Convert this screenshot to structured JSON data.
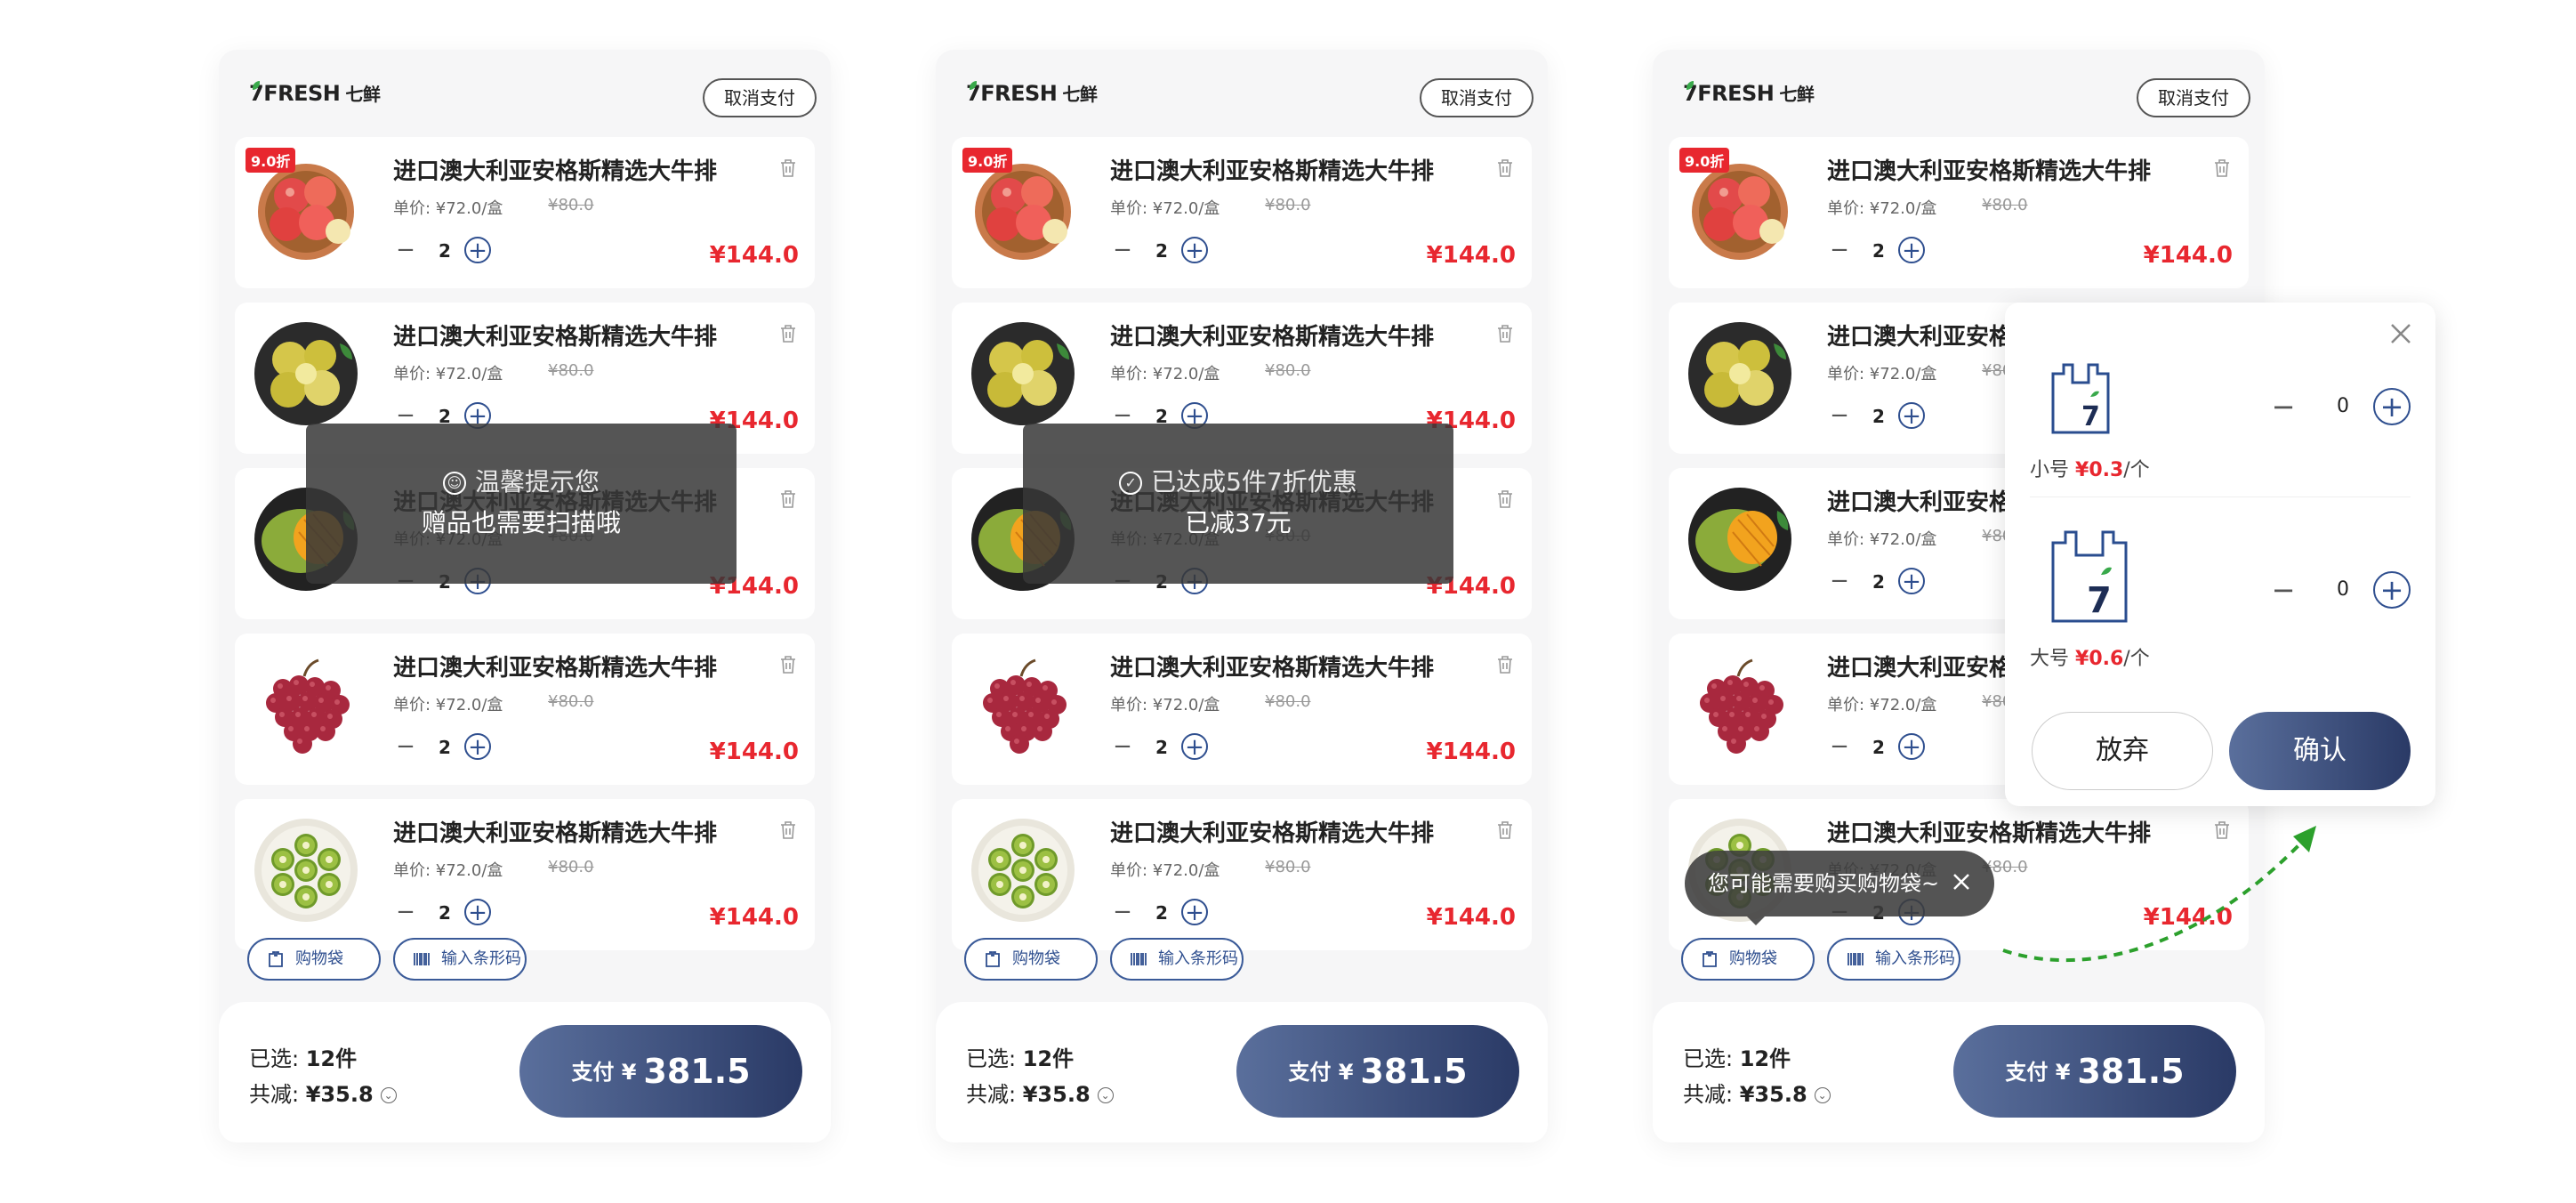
{
  "app": {
    "logo_text": "7FRESH",
    "logo_cn": "七鲜",
    "cancel_pay": "取消支付"
  },
  "product": {
    "name": "进口澳大利亚安格斯精选大牛排",
    "unit_price": "单价: ¥72.0/盒",
    "original_price": "¥80.0",
    "qty": "2",
    "total": "¥144.0",
    "discount_badge": "9.0折",
    "minus_symbol": "−",
    "plus_symbol": "+"
  },
  "products": [
    {
      "fruit": "apple",
      "badge": true
    },
    {
      "fruit": "pear",
      "badge": false
    },
    {
      "fruit": "mango",
      "badge": false
    },
    {
      "fruit": "grape",
      "badge": false
    },
    {
      "fruit": "kiwi",
      "badge": false
    }
  ],
  "chips": {
    "bag": "购物袋",
    "barcode": "输入条形码"
  },
  "footer": {
    "selected_label": "已选:",
    "selected_value": "12件",
    "discount_label": "共减:",
    "discount_value": "¥35.8",
    "pay_label": "支付 ¥",
    "pay_amount": "381.5"
  },
  "toast1": {
    "line1": "温馨提示您",
    "line2": "赠品也需要扫描哦",
    "icon": "smile-icon"
  },
  "toast2": {
    "line1": "已达成5件7折优惠",
    "line2": "已减37元",
    "icon": "check-circle-icon"
  },
  "bag_popover": {
    "small_label": "小号",
    "small_price": "¥0.3",
    "large_label": "大号",
    "large_price": "¥0.6",
    "per_unit": "/个",
    "small_qty": "0",
    "large_qty": "0",
    "cancel": "放弃",
    "confirm": "确认"
  },
  "bag_tip": {
    "text": "您可能需要购买购物袋~"
  },
  "colors": {
    "accent": "#2f4f8f",
    "price_red": "#e8272f",
    "arrow_green": "#2ca02c"
  }
}
